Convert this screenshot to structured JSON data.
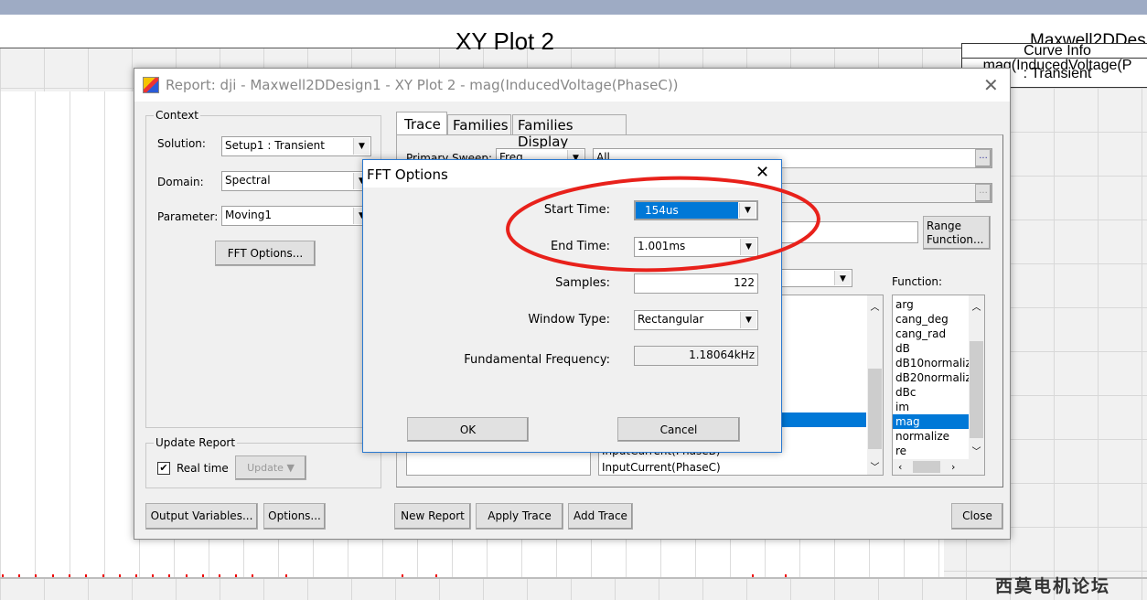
{
  "plot": {
    "title": "XY Plot 2",
    "design": "Maxwell2DDes",
    "curve_info_header": "Curve Info",
    "curve_info_line1": "mag(InducedVoltage(P",
    "curve_info_line2": ": Transient"
  },
  "watermark": "西莫电机论坛",
  "report": {
    "title": "Report: dji - Maxwell2DDesign1 - XY Plot 2 - mag(InducedVoltage(PhaseC))",
    "context": {
      "label": "Context",
      "solution_label": "Solution:",
      "solution": "Setup1 : Transient",
      "domain_label": "Domain:",
      "domain": "Spectral",
      "parameter_label": "Parameter:",
      "parameter": "Moving1",
      "fft_button": "FFT Options..."
    },
    "update": {
      "label": "Update Report",
      "realtime_label": "Real time",
      "realtime_checked": true,
      "update_button": "Update"
    },
    "tabs": [
      "Trace",
      "Families",
      "Families Display"
    ],
    "trace": {
      "primary_sweep_label": "Primary Sweep:",
      "primary_sweep": "Freq",
      "sweep_values": "All",
      "ellipsis": "...",
      "range_function": "Range Function...",
      "function_label": "Function:",
      "functions": [
        "arg",
        "cang_deg",
        "cang_rad",
        "dB",
        "dB10normaliz",
        "dB20normaliz",
        "dBc",
        "im",
        "mag",
        "normalize",
        "re"
      ],
      "selected_function": "mag",
      "quantities": [
        "InputCurrent(PhaseB)",
        "InputCurrent(PhaseC)"
      ]
    },
    "buttons": {
      "output_variables": "Output Variables...",
      "options": "Options...",
      "new_report": "New Report",
      "apply_trace": "Apply Trace",
      "add_trace": "Add Trace",
      "close": "Close"
    }
  },
  "fft": {
    "title": "FFT Options",
    "start_time_label": "Start Time:",
    "start_time": "154us",
    "end_time_label": "End Time:",
    "end_time": "1.001ms",
    "samples_label": "Samples:",
    "samples": "122",
    "window_type_label": "Window Type:",
    "window_type": "Rectangular",
    "fundamental_label": "Fundamental Frequency:",
    "fundamental": "1.18064kHz",
    "ok": "OK",
    "cancel": "Cancel"
  },
  "colors": {
    "accent": "#0078d7",
    "annotation": "#e8211b"
  }
}
